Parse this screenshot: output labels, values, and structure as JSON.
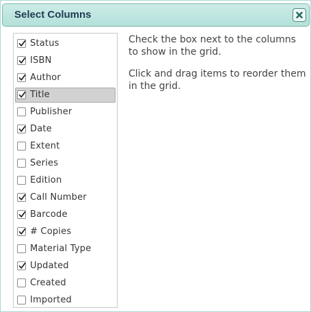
{
  "dialog": {
    "title": "Select Columns",
    "close_icon": "close-x-icon",
    "accent_color": "#b4e0da"
  },
  "columns": [
    {
      "label": "Status",
      "checked": true,
      "selected": false
    },
    {
      "label": "ISBN",
      "checked": true,
      "selected": false
    },
    {
      "label": "Author",
      "checked": true,
      "selected": false
    },
    {
      "label": "Title",
      "checked": true,
      "selected": true
    },
    {
      "label": "Publisher",
      "checked": false,
      "selected": false
    },
    {
      "label": "Date",
      "checked": true,
      "selected": false
    },
    {
      "label": "Extent",
      "checked": false,
      "selected": false
    },
    {
      "label": "Series",
      "checked": false,
      "selected": false
    },
    {
      "label": "Edition",
      "checked": false,
      "selected": false
    },
    {
      "label": "Call Number",
      "checked": true,
      "selected": false
    },
    {
      "label": "Barcode",
      "checked": true,
      "selected": false
    },
    {
      "label": "# Copies",
      "checked": true,
      "selected": false
    },
    {
      "label": "Material Type",
      "checked": false,
      "selected": false
    },
    {
      "label": "Updated",
      "checked": true,
      "selected": false
    },
    {
      "label": "Created",
      "checked": false,
      "selected": false
    },
    {
      "label": "Imported",
      "checked": false,
      "selected": false
    }
  ],
  "help": {
    "line1": "Check the box next to the columns to show in the grid.",
    "line2": "Click and drag items to reorder them in the grid."
  }
}
